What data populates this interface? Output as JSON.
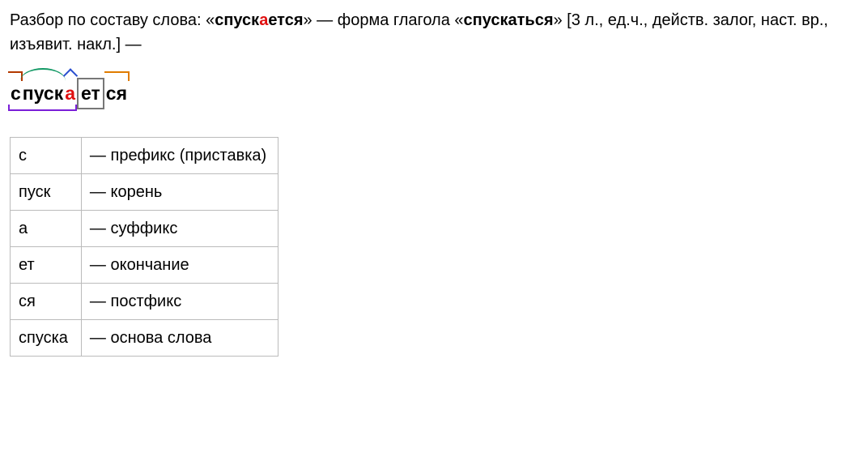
{
  "intro": {
    "lead": "Разбор по составу слова: «",
    "word_pre": "спуск",
    "word_stress": "а",
    "word_post": "ется",
    "mid": "» — форма глагола «",
    "verb": "спускаться",
    "after_verb": "» [3 л., ед.ч., действ. залог, наст. вр., изъявит. накл.] —"
  },
  "morphemes": {
    "prefix": "с",
    "root": "пуск",
    "suffix": "а",
    "ending": "ет",
    "postfix": "ся"
  },
  "table": [
    {
      "part": "с",
      "dash": "— ",
      "desc": "префикс (приставка)"
    },
    {
      "part": "пуск",
      "dash": "— ",
      "desc": "корень"
    },
    {
      "part": "а",
      "dash": "— ",
      "desc": "суффикс"
    },
    {
      "part": "ет",
      "dash": "— ",
      "desc": "окончание"
    },
    {
      "part": "ся",
      "dash": "— ",
      "desc": "постфикс"
    },
    {
      "part": "спуска",
      "dash": "— ",
      "desc": "основа слова"
    }
  ]
}
